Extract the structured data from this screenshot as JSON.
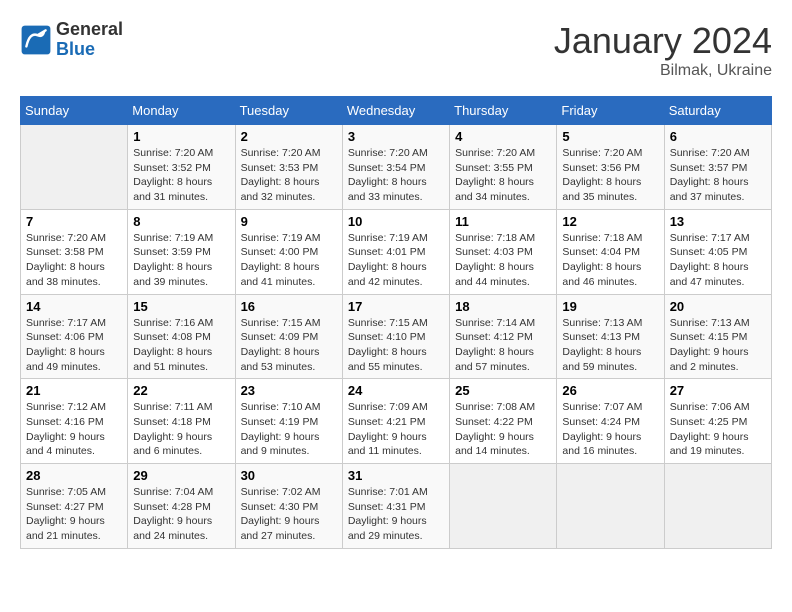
{
  "header": {
    "logo_general": "General",
    "logo_blue": "Blue",
    "month": "January 2024",
    "location": "Bilmak, Ukraine"
  },
  "weekdays": [
    "Sunday",
    "Monday",
    "Tuesday",
    "Wednesday",
    "Thursday",
    "Friday",
    "Saturday"
  ],
  "weeks": [
    [
      {
        "day": "",
        "sunrise": "",
        "sunset": "",
        "daylight": ""
      },
      {
        "day": "1",
        "sunrise": "Sunrise: 7:20 AM",
        "sunset": "Sunset: 3:52 PM",
        "daylight": "Daylight: 8 hours and 31 minutes."
      },
      {
        "day": "2",
        "sunrise": "Sunrise: 7:20 AM",
        "sunset": "Sunset: 3:53 PM",
        "daylight": "Daylight: 8 hours and 32 minutes."
      },
      {
        "day": "3",
        "sunrise": "Sunrise: 7:20 AM",
        "sunset": "Sunset: 3:54 PM",
        "daylight": "Daylight: 8 hours and 33 minutes."
      },
      {
        "day": "4",
        "sunrise": "Sunrise: 7:20 AM",
        "sunset": "Sunset: 3:55 PM",
        "daylight": "Daylight: 8 hours and 34 minutes."
      },
      {
        "day": "5",
        "sunrise": "Sunrise: 7:20 AM",
        "sunset": "Sunset: 3:56 PM",
        "daylight": "Daylight: 8 hours and 35 minutes."
      },
      {
        "day": "6",
        "sunrise": "Sunrise: 7:20 AM",
        "sunset": "Sunset: 3:57 PM",
        "daylight": "Daylight: 8 hours and 37 minutes."
      }
    ],
    [
      {
        "day": "7",
        "sunrise": "Sunrise: 7:20 AM",
        "sunset": "Sunset: 3:58 PM",
        "daylight": "Daylight: 8 hours and 38 minutes."
      },
      {
        "day": "8",
        "sunrise": "Sunrise: 7:19 AM",
        "sunset": "Sunset: 3:59 PM",
        "daylight": "Daylight: 8 hours and 39 minutes."
      },
      {
        "day": "9",
        "sunrise": "Sunrise: 7:19 AM",
        "sunset": "Sunset: 4:00 PM",
        "daylight": "Daylight: 8 hours and 41 minutes."
      },
      {
        "day": "10",
        "sunrise": "Sunrise: 7:19 AM",
        "sunset": "Sunset: 4:01 PM",
        "daylight": "Daylight: 8 hours and 42 minutes."
      },
      {
        "day": "11",
        "sunrise": "Sunrise: 7:18 AM",
        "sunset": "Sunset: 4:03 PM",
        "daylight": "Daylight: 8 hours and 44 minutes."
      },
      {
        "day": "12",
        "sunrise": "Sunrise: 7:18 AM",
        "sunset": "Sunset: 4:04 PM",
        "daylight": "Daylight: 8 hours and 46 minutes."
      },
      {
        "day": "13",
        "sunrise": "Sunrise: 7:17 AM",
        "sunset": "Sunset: 4:05 PM",
        "daylight": "Daylight: 8 hours and 47 minutes."
      }
    ],
    [
      {
        "day": "14",
        "sunrise": "Sunrise: 7:17 AM",
        "sunset": "Sunset: 4:06 PM",
        "daylight": "Daylight: 8 hours and 49 minutes."
      },
      {
        "day": "15",
        "sunrise": "Sunrise: 7:16 AM",
        "sunset": "Sunset: 4:08 PM",
        "daylight": "Daylight: 8 hours and 51 minutes."
      },
      {
        "day": "16",
        "sunrise": "Sunrise: 7:15 AM",
        "sunset": "Sunset: 4:09 PM",
        "daylight": "Daylight: 8 hours and 53 minutes."
      },
      {
        "day": "17",
        "sunrise": "Sunrise: 7:15 AM",
        "sunset": "Sunset: 4:10 PM",
        "daylight": "Daylight: 8 hours and 55 minutes."
      },
      {
        "day": "18",
        "sunrise": "Sunrise: 7:14 AM",
        "sunset": "Sunset: 4:12 PM",
        "daylight": "Daylight: 8 hours and 57 minutes."
      },
      {
        "day": "19",
        "sunrise": "Sunrise: 7:13 AM",
        "sunset": "Sunset: 4:13 PM",
        "daylight": "Daylight: 8 hours and 59 minutes."
      },
      {
        "day": "20",
        "sunrise": "Sunrise: 7:13 AM",
        "sunset": "Sunset: 4:15 PM",
        "daylight": "Daylight: 9 hours and 2 minutes."
      }
    ],
    [
      {
        "day": "21",
        "sunrise": "Sunrise: 7:12 AM",
        "sunset": "Sunset: 4:16 PM",
        "daylight": "Daylight: 9 hours and 4 minutes."
      },
      {
        "day": "22",
        "sunrise": "Sunrise: 7:11 AM",
        "sunset": "Sunset: 4:18 PM",
        "daylight": "Daylight: 9 hours and 6 minutes."
      },
      {
        "day": "23",
        "sunrise": "Sunrise: 7:10 AM",
        "sunset": "Sunset: 4:19 PM",
        "daylight": "Daylight: 9 hours and 9 minutes."
      },
      {
        "day": "24",
        "sunrise": "Sunrise: 7:09 AM",
        "sunset": "Sunset: 4:21 PM",
        "daylight": "Daylight: 9 hours and 11 minutes."
      },
      {
        "day": "25",
        "sunrise": "Sunrise: 7:08 AM",
        "sunset": "Sunset: 4:22 PM",
        "daylight": "Daylight: 9 hours and 14 minutes."
      },
      {
        "day": "26",
        "sunrise": "Sunrise: 7:07 AM",
        "sunset": "Sunset: 4:24 PM",
        "daylight": "Daylight: 9 hours and 16 minutes."
      },
      {
        "day": "27",
        "sunrise": "Sunrise: 7:06 AM",
        "sunset": "Sunset: 4:25 PM",
        "daylight": "Daylight: 9 hours and 19 minutes."
      }
    ],
    [
      {
        "day": "28",
        "sunrise": "Sunrise: 7:05 AM",
        "sunset": "Sunset: 4:27 PM",
        "daylight": "Daylight: 9 hours and 21 minutes."
      },
      {
        "day": "29",
        "sunrise": "Sunrise: 7:04 AM",
        "sunset": "Sunset: 4:28 PM",
        "daylight": "Daylight: 9 hours and 24 minutes."
      },
      {
        "day": "30",
        "sunrise": "Sunrise: 7:02 AM",
        "sunset": "Sunset: 4:30 PM",
        "daylight": "Daylight: 9 hours and 27 minutes."
      },
      {
        "day": "31",
        "sunrise": "Sunrise: 7:01 AM",
        "sunset": "Sunset: 4:31 PM",
        "daylight": "Daylight: 9 hours and 29 minutes."
      },
      {
        "day": "",
        "sunrise": "",
        "sunset": "",
        "daylight": ""
      },
      {
        "day": "",
        "sunrise": "",
        "sunset": "",
        "daylight": ""
      },
      {
        "day": "",
        "sunrise": "",
        "sunset": "",
        "daylight": ""
      }
    ]
  ]
}
